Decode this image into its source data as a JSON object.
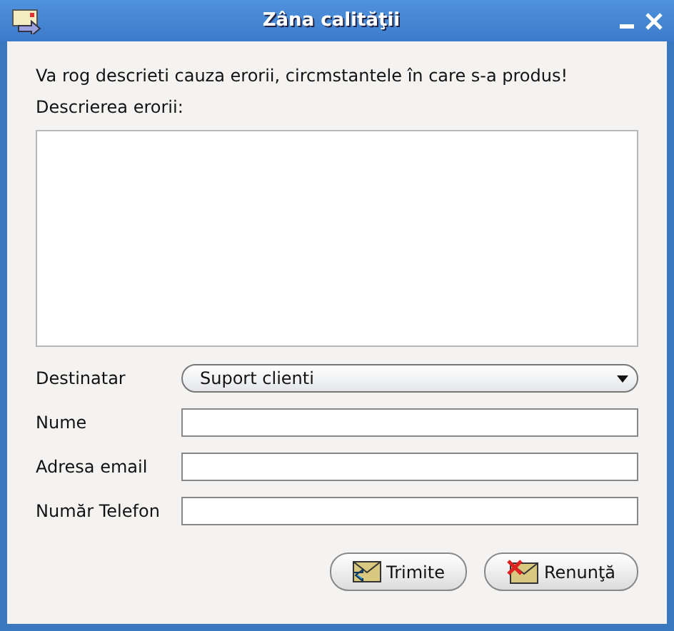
{
  "window": {
    "title": "Zâna calităţii"
  },
  "instruction": "Va rog descrieti cauza erorii, circmstantele în care s-a produs!",
  "description_label": "Descrierea erorii:",
  "fields": [
    {
      "label": "Destinatar",
      "kind": "dropdown",
      "value": "Suport clienti"
    },
    {
      "label": "Nume",
      "kind": "text"
    },
    {
      "label": "Adresa email",
      "kind": "text"
    },
    {
      "label": "Număr Telefon",
      "kind": "text"
    }
  ],
  "buttons": [
    {
      "label": "Trimite",
      "kind": "send"
    },
    {
      "label": "Renunţă",
      "kind": "cancel"
    }
  ]
}
